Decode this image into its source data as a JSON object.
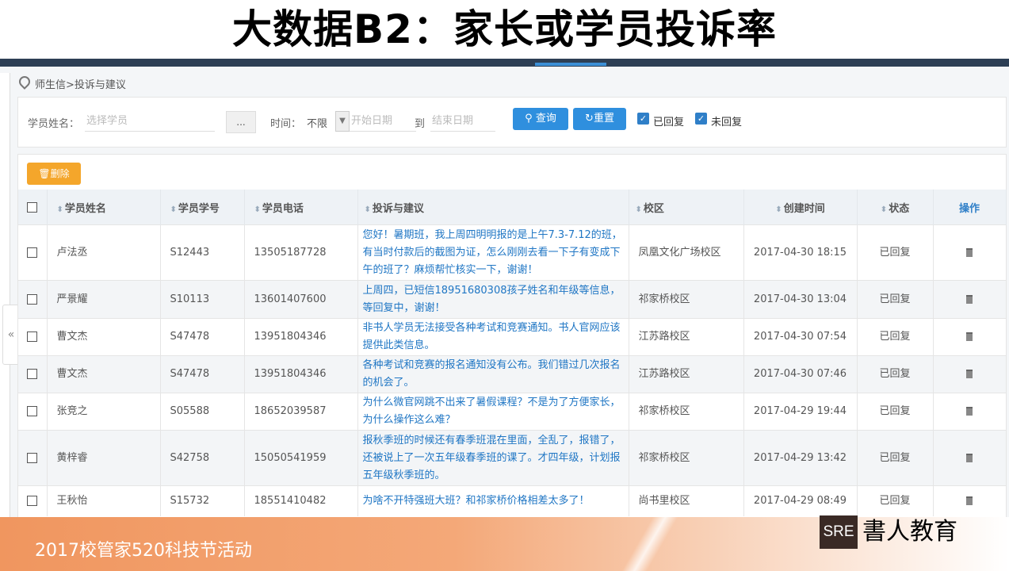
{
  "slide": {
    "title": "大数据B2：家长或学员投诉率",
    "footer": "2017校管家520科技节活动",
    "logo_mark": "SRE",
    "logo_text": "書人教育"
  },
  "breadcrumb": "师生信>投诉与建议",
  "filter": {
    "student_label": "学员姓名：",
    "student_placeholder": "选择学员",
    "more_button": "...",
    "time_label": "时间：",
    "time_select": "不限",
    "start_placeholder": "开始日期",
    "to_label": "到",
    "end_placeholder": "结束日期",
    "query_button": "查询",
    "reset_button": "重置",
    "replied_label": "已回复",
    "unreplied_label": "未回复"
  },
  "toolbar": {
    "delete_button": "删除"
  },
  "table": {
    "headers": [
      "学员姓名",
      "学员学号",
      "学员电话",
      "投诉与建议",
      "校区",
      "创建时间",
      "状态",
      "操作"
    ],
    "rows": [
      {
        "name": "卢法丞",
        "id": "S12443",
        "phone": "13505187728",
        "content": "您好！暑期班，我上周四明明报的是上午7.3-7.12的班，有当时付款后的截图为证，怎么刚刚去看一下子有变成下午的班了？麻烦帮忙核实一下，谢谢！",
        "campus": "凤凰文化广场校区",
        "time": "2017-04-30 18:15",
        "status": "已回复"
      },
      {
        "name": "严景耀",
        "id": "S10113",
        "phone": "13601407600",
        "content": "上周四，已短信18951680308孩子姓名和年级等信息，等回复中，谢谢！",
        "campus": "祁家桥校区",
        "time": "2017-04-30 13:04",
        "status": "已回复"
      },
      {
        "name": "曹文杰",
        "id": "S47478",
        "phone": "13951804346",
        "content": "非书人学员无法接受各种考试和竞赛通知。书人官网应该提供此类信息。",
        "campus": "江苏路校区",
        "time": "2017-04-30 07:54",
        "status": "已回复"
      },
      {
        "name": "曹文杰",
        "id": "S47478",
        "phone": "13951804346",
        "content": "各种考试和竞赛的报名通知没有公布。我们错过几次报名的机会了。",
        "campus": "江苏路校区",
        "time": "2017-04-30 07:46",
        "status": "已回复"
      },
      {
        "name": "张竞之",
        "id": "S05588",
        "phone": "18652039587",
        "content": "为什么微官网跳不出来了暑假课程？不是为了方便家长，为什么操作这么难？",
        "campus": "祁家桥校区",
        "time": "2017-04-29 19:44",
        "status": "已回复"
      },
      {
        "name": "黄梓睿",
        "id": "S42758",
        "phone": "15050541959",
        "content": "报秋季班的时候还有春季班混在里面，全乱了，报错了，还被说上了一次五年级春季班的课了。才四年级，计划报五年级秋季班的。",
        "campus": "祁家桥校区",
        "time": "2017-04-29 13:42",
        "status": "已回复"
      },
      {
        "name": "王秋怡",
        "id": "S15732",
        "phone": "18551410482",
        "content": "为啥不开特强班大班？和祁家桥价格相差太多了！",
        "campus": "尚书里校区",
        "time": "2017-04-29 08:49",
        "status": "已回复"
      }
    ]
  }
}
